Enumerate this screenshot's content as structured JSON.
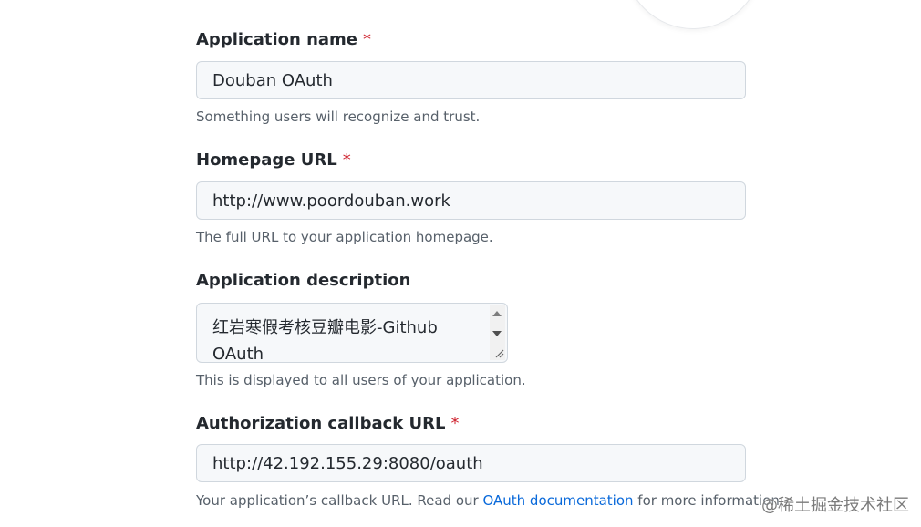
{
  "form": {
    "app_name": {
      "label": "Application name",
      "required_mark": "*",
      "value": "Douban OAuth",
      "hint": "Something users will recognize and trust."
    },
    "homepage_url": {
      "label": "Homepage URL",
      "required_mark": "*",
      "value": "http://www.poordouban.work",
      "hint": "The full URL to your application homepage."
    },
    "description": {
      "label": "Application description",
      "value": "红岩寒假考核豆瓣电影-Github OAuth",
      "hint": "This is displayed to all users of your application."
    },
    "callback_url": {
      "label": "Authorization callback URL",
      "required_mark": "*",
      "value": "http://42.192.155.29:8080/oauth",
      "hint_prefix": "Your application’s callback URL. Read our ",
      "hint_link": "OAuth documentation",
      "hint_suffix": " for more information."
    }
  },
  "watermark": "@稀土掘金技术社区",
  "colors": {
    "required": "#cf222e",
    "link": "#0969da",
    "input_bg": "#f6f8fa",
    "input_border": "#d0d7de",
    "hint": "#57606a"
  },
  "icons": {
    "scroll_up": "triangle-up",
    "scroll_down": "triangle-down",
    "resize_grip": "diagonal-lines"
  }
}
